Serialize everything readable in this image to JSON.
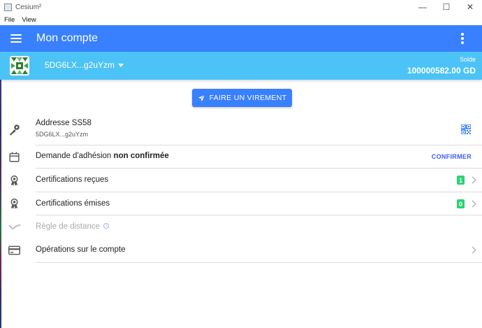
{
  "window": {
    "title": "Cesium²",
    "controls": {
      "minimize": "—",
      "maximize": "☐",
      "close": "✕"
    }
  },
  "menu": {
    "items": [
      "File",
      "View"
    ]
  },
  "appbar": {
    "title": "Mon compte"
  },
  "account": {
    "address_short": "5DG6LX...g2uYzm",
    "balance_label": "Solde",
    "balance_value": "100000582.00 GD"
  },
  "actions": {
    "transfer_label": "FAIRE UN VIREMENT"
  },
  "rows": {
    "address": {
      "label": "Addresse SS58",
      "value": "5DG6LX...g2uYzm"
    },
    "membership": {
      "text": "Demande d'adhésion",
      "status": "non confirmée",
      "action": "CONFIRMER"
    },
    "certs_received": {
      "label": "Certifications reçues",
      "count": "1"
    },
    "certs_issued": {
      "label": "Certifications émises",
      "count": "0"
    },
    "distance_rule": {
      "label": "Règle de distance",
      "info_glyph": "i"
    },
    "operations": {
      "label": "Opérations sur le compte"
    }
  },
  "colors": {
    "primary": "#3880ff",
    "account_bar": "#4cc3f7",
    "danger": "#eb445a",
    "success_badge": "#2dd36f",
    "confirm": "#3d5afe"
  }
}
